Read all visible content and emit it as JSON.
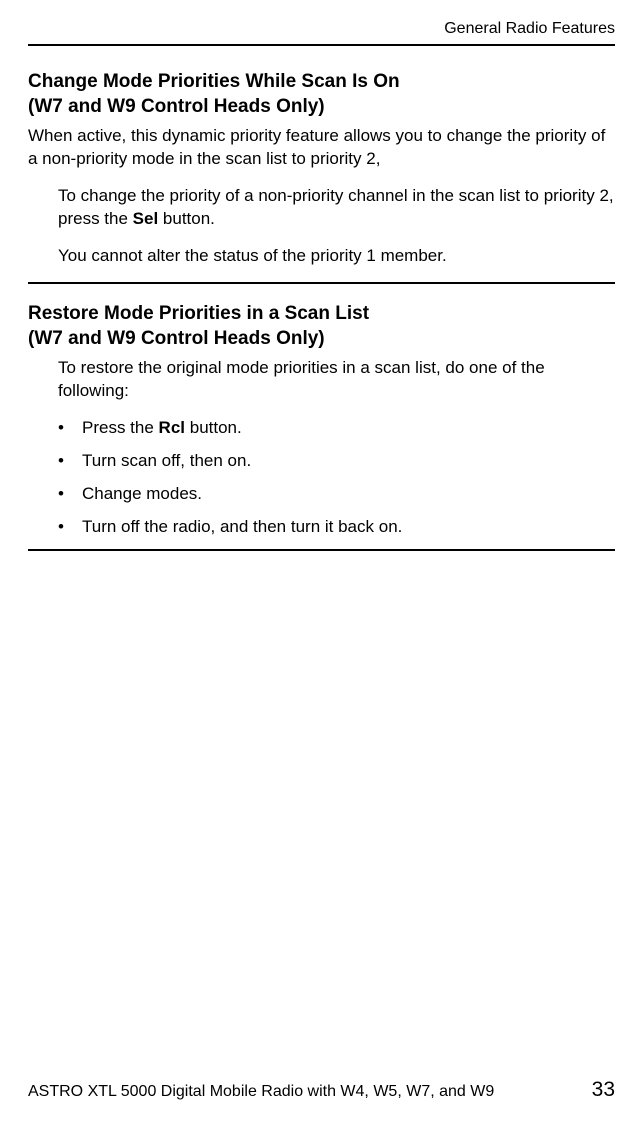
{
  "header": {
    "title": "General Radio Features"
  },
  "section1": {
    "heading_line1": "Change Mode Priorities While Scan Is On",
    "heading_line2": "(W7 and W9 Control Heads Only)",
    "intro": "When active, this dynamic priority feature allows you to change the priority of a non-priority mode in the scan list to priority 2,",
    "step_pre": "To change the priority of a non-priority channel in the scan list to priority 2, press the ",
    "step_bold": "Sel",
    "step_post": " button.",
    "note": "You cannot alter the status of the priority 1 member."
  },
  "section2": {
    "heading_line1": "Restore Mode Priorities in a Scan List",
    "heading_line2": "(W7 and W9 Control Heads Only)",
    "intro": "To restore the original mode priorities in a scan list, do one of the following:",
    "bullets": [
      {
        "pre": "Press the ",
        "bold": "Rcl",
        "post": " button."
      },
      {
        "pre": "Turn scan off, then on.",
        "bold": "",
        "post": ""
      },
      {
        "pre": "Change modes.",
        "bold": "",
        "post": ""
      },
      {
        "pre": "Turn off the radio, and then turn it back on.",
        "bold": "",
        "post": ""
      }
    ]
  },
  "footer": {
    "text": "ASTRO XTL 5000 Digital Mobile Radio with W4, W5, W7, and W9",
    "page": "33"
  }
}
